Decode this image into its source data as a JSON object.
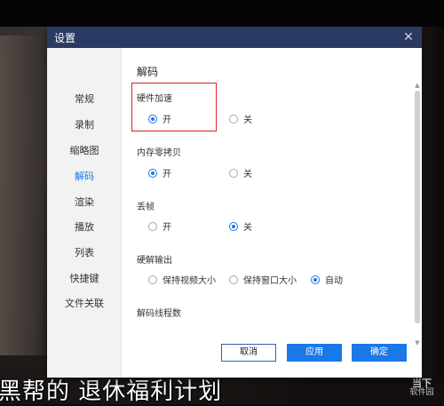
{
  "dialog": {
    "title": "设置",
    "close_icon": "close-icon",
    "sidebar": {
      "items": [
        {
          "label": "常规"
        },
        {
          "label": "录制"
        },
        {
          "label": "缩略图"
        },
        {
          "label": "解码",
          "active": true
        },
        {
          "label": "渲染"
        },
        {
          "label": "播放"
        },
        {
          "label": "列表"
        },
        {
          "label": "快捷键"
        },
        {
          "label": "文件关联"
        }
      ]
    },
    "section_title": "解码",
    "groups": {
      "hw_accel": {
        "label": "硬件加速",
        "options": [
          "开",
          "关"
        ],
        "selected": "开"
      },
      "zero_copy": {
        "label": "内存零拷贝",
        "options": [
          "开",
          "关"
        ],
        "selected": "开"
      },
      "drop_frames": {
        "label": "丢帧",
        "options": [
          "开",
          "关"
        ],
        "selected": "关"
      },
      "hw_output": {
        "label": "硬解输出",
        "options": [
          "保持视频大小",
          "保持窗口大小",
          "自动"
        ],
        "selected": "自动"
      },
      "decode_threads": {
        "label": "解码线程数"
      }
    },
    "buttons": {
      "cancel": "取消",
      "apply": "应用",
      "ok": "确定"
    }
  },
  "video": {
    "subtitle": "黑帮的 退休福利计划"
  },
  "watermark": {
    "line1": "当下",
    "line2": "软件园"
  },
  "colors": {
    "titlebar": "#2b3a63",
    "accent": "#1a78e8",
    "highlight": "#e02020"
  }
}
